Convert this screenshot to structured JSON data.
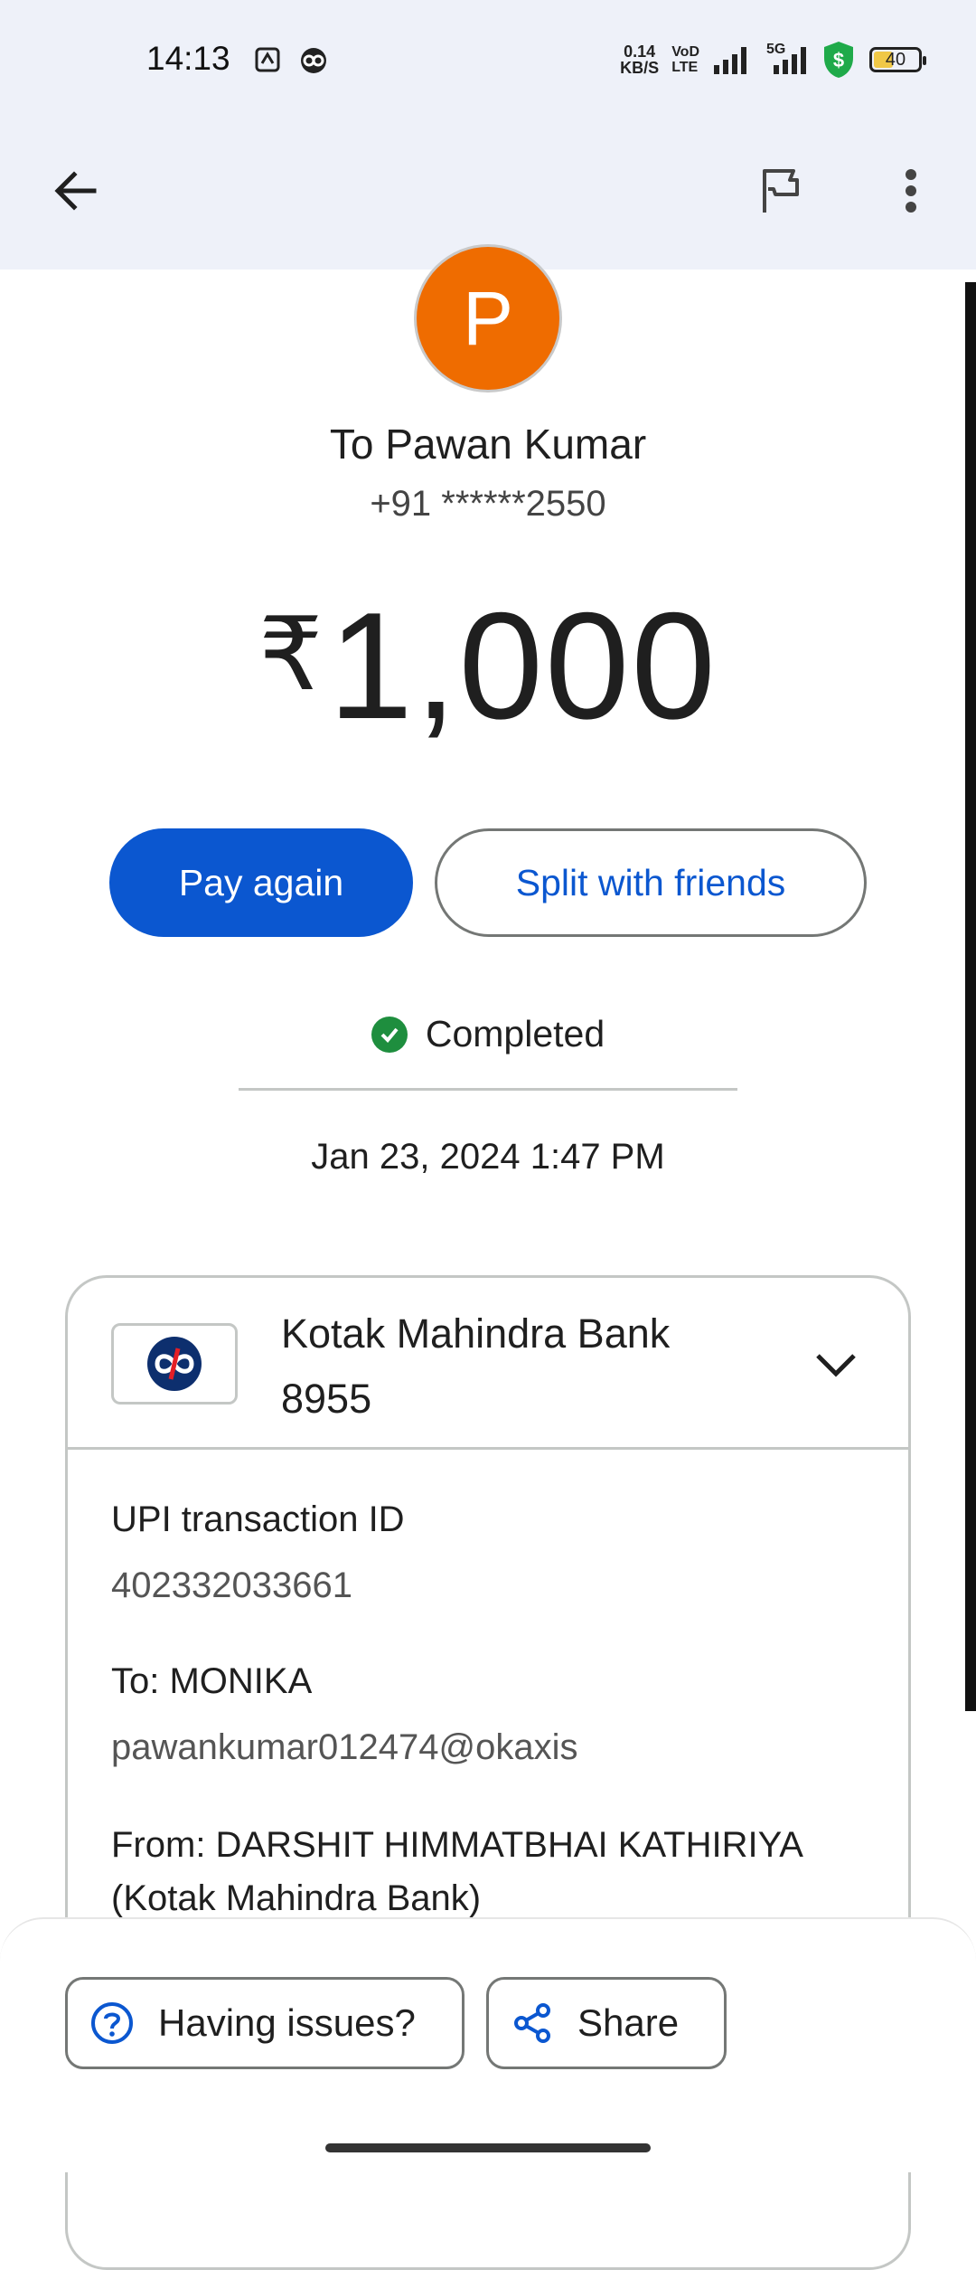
{
  "status_bar": {
    "time": "14:13",
    "net_speed_value": "0.14",
    "net_speed_unit": "KB/S",
    "volte_top": "VoD",
    "volte_bottom": "LTE",
    "network": "5G",
    "battery": "40"
  },
  "app_bar": {
    "back_icon": "arrow-left-icon",
    "flag_icon": "flag-icon",
    "more_icon": "more-vert-icon"
  },
  "recipient": {
    "avatar_letter": "P",
    "avatar_color": "#ef6c00",
    "name_line": "To Pawan Kumar",
    "phone": "+91 ******2550"
  },
  "amount": {
    "currency": "₹",
    "value": "1,000"
  },
  "actions": {
    "pay_again": "Pay again",
    "split": "Split with friends"
  },
  "transaction": {
    "status": "Completed",
    "status_color": "#1e8e3e",
    "datetime": "Jan 23, 2024 1:47 PM"
  },
  "bank": {
    "name": "Kotak Mahindra Bank",
    "account_last4": "8955"
  },
  "details": {
    "upi_label": "UPI transaction ID",
    "upi_value": "402332033661",
    "to_label": "To: MONIKA",
    "to_value": "pawankumar012474@okaxis",
    "from_line1": "From: DARSHIT HIMMATBHAI KATHIRIYA",
    "from_line2": "(Kotak Mahindra Bank)"
  },
  "bottom": {
    "issues": "Having issues?",
    "share": "Share"
  },
  "colors": {
    "primary": "#0b57d0",
    "appbar_bg": "#eef1f9"
  }
}
